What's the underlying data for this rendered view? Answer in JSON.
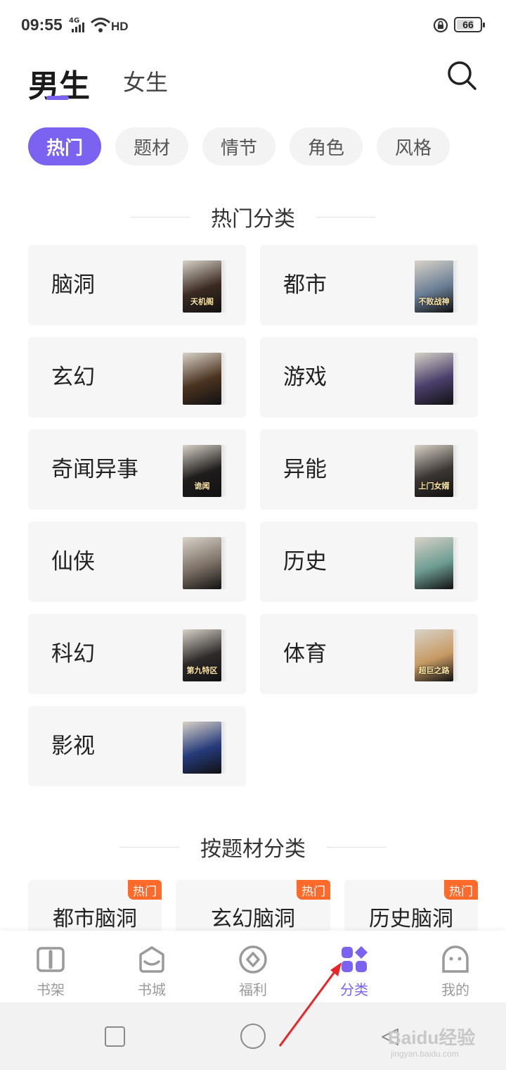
{
  "status_bar": {
    "time": "09:55",
    "network": "4G",
    "hd": "HD",
    "battery": "66",
    "battery_fraction": 0.66
  },
  "header": {
    "tab_male": "男生",
    "tab_female": "女生",
    "search_icon": "search-icon"
  },
  "chips": [
    "热门",
    "题材",
    "情节",
    "角色",
    "风格"
  ],
  "active_chip": 0,
  "hot_section": {
    "title": "热门分类",
    "categories": [
      {
        "name": "脑洞",
        "cover_text": "天机阁",
        "cover_color": "#3a2a22"
      },
      {
        "name": "都市",
        "cover_text": "不败战神",
        "cover_color": "#6a7e95"
      },
      {
        "name": "玄幻",
        "cover_text": "",
        "cover_color": "#4a3320"
      },
      {
        "name": "游戏",
        "cover_text": "",
        "cover_color": "#4a3f6b"
      },
      {
        "name": "奇闻异事",
        "cover_text": "诡闻",
        "cover_color": "#1f1d1c"
      },
      {
        "name": "异能",
        "cover_text": "上门女婿",
        "cover_color": "#3a3532"
      },
      {
        "name": "仙侠",
        "cover_text": "",
        "cover_color": "#7c7066"
      },
      {
        "name": "历史",
        "cover_text": "",
        "cover_color": "#6e9c92"
      },
      {
        "name": "科幻",
        "cover_text": "第九特区",
        "cover_color": "#2d2a2a"
      },
      {
        "name": "体育",
        "cover_text": "超巨之路",
        "cover_color": "#c79a64"
      },
      {
        "name": "影视",
        "cover_text": "",
        "cover_color": "#253a7a"
      }
    ]
  },
  "theme_section": {
    "title": "按题材分类",
    "hot_badge": "热门",
    "items": [
      "都市脑洞",
      "玄幻脑洞",
      "历史脑洞"
    ]
  },
  "bottom_nav": {
    "items": [
      {
        "label": "书架",
        "icon": "bookshelf-icon"
      },
      {
        "label": "书城",
        "icon": "bookstore-icon"
      },
      {
        "label": "福利",
        "icon": "welfare-icon"
      },
      {
        "label": "分类",
        "icon": "category-icon"
      },
      {
        "label": "我的",
        "icon": "profile-icon"
      }
    ],
    "active": 3
  },
  "watermark": {
    "text": "Baidu经验",
    "sub": "jingyan.baidu.com"
  },
  "colors": {
    "accent": "#7b62f0",
    "hot_badge": "#ff6a2b",
    "annotation_arrow": "#e8262a"
  }
}
